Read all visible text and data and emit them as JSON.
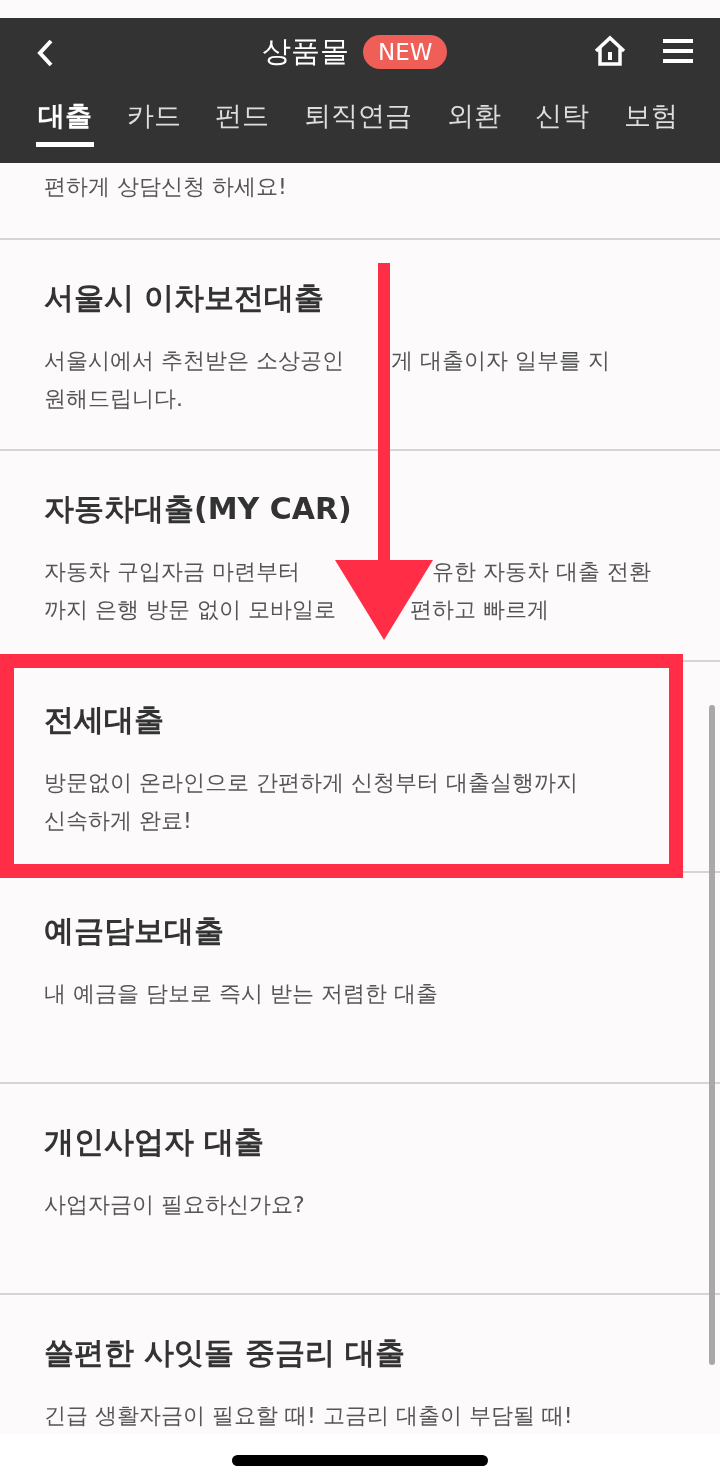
{
  "header": {
    "title": "상품몰",
    "badge": "NEW",
    "tabs": [
      {
        "label": "대출",
        "selected": true
      },
      {
        "label": "카드",
        "selected": false
      },
      {
        "label": "펀드",
        "selected": false
      },
      {
        "label": "퇴직연금",
        "selected": false
      },
      {
        "label": "외환",
        "selected": false
      },
      {
        "label": "신탁",
        "selected": false
      },
      {
        "label": "보험",
        "selected": false
      }
    ]
  },
  "products": [
    {
      "lines": [
        [
          "편하게 상담신청 하세요!"
        ]
      ],
      "highlighted": false
    },
    {
      "title": "서울시 이차보전대출",
      "lines": [
        [
          "서울시에서 추천받은 소상공인",
          "게 대출이자 일부를 지"
        ],
        [
          "원해드립니다."
        ]
      ],
      "highlighted": false
    },
    {
      "title": "자동차대출(MY CAR)",
      "lines": [
        [
          "자동차 구입자금 마련부터",
          "유한 자동차 대출 전환"
        ],
        [
          "까지 은행 방문 없이 모바일로",
          "편하고 빠르게"
        ]
      ],
      "highlighted": false
    },
    {
      "title": "전세대출",
      "lines": [
        [
          "방문없이 온라인으로 간편하게 신청부터 대출실행까지"
        ],
        [
          "신속하게 완료!"
        ]
      ],
      "highlighted": true
    },
    {
      "title": "예금담보대출",
      "lines": [
        [
          "내 예금을 담보로 즉시 받는 저렴한 대출"
        ]
      ],
      "highlighted": false
    },
    {
      "title": "개인사업자 대출",
      "lines": [
        [
          "사업자금이 필요하신가요?"
        ]
      ],
      "highlighted": false
    },
    {
      "title": "쓸편한 사잇돌 중금리 대출",
      "lines": [
        [
          "긴급 생활자금이 필요할 때! 고금리 대출이 부담될 때!"
        ]
      ],
      "highlighted": false
    }
  ]
}
